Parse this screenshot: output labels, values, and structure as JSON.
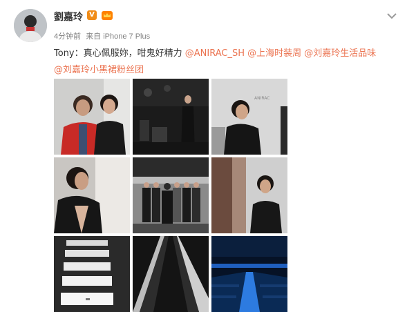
{
  "post": {
    "username": "劉嘉玲",
    "vip_badge": "V",
    "time": "4分钟前",
    "source": "来自 iPhone 7 Plus",
    "text_prefix": "Tony：真心佩服妳，咁鬼好精力",
    "mentions": [
      "@ANIRAC_SH",
      "@上海时装周",
      "@刘嘉玲生活品味",
      "@刘嘉玲小黑裙粉丝团"
    ],
    "runway_logo": "ANIRAC"
  },
  "icons": {
    "badge": "vip-v-icon",
    "crown": "crown-badge-icon",
    "menu": "chevron-down-icon"
  },
  "colors": {
    "mention": "#eb7350",
    "vip": "#f08c18",
    "meta": "#808080"
  }
}
